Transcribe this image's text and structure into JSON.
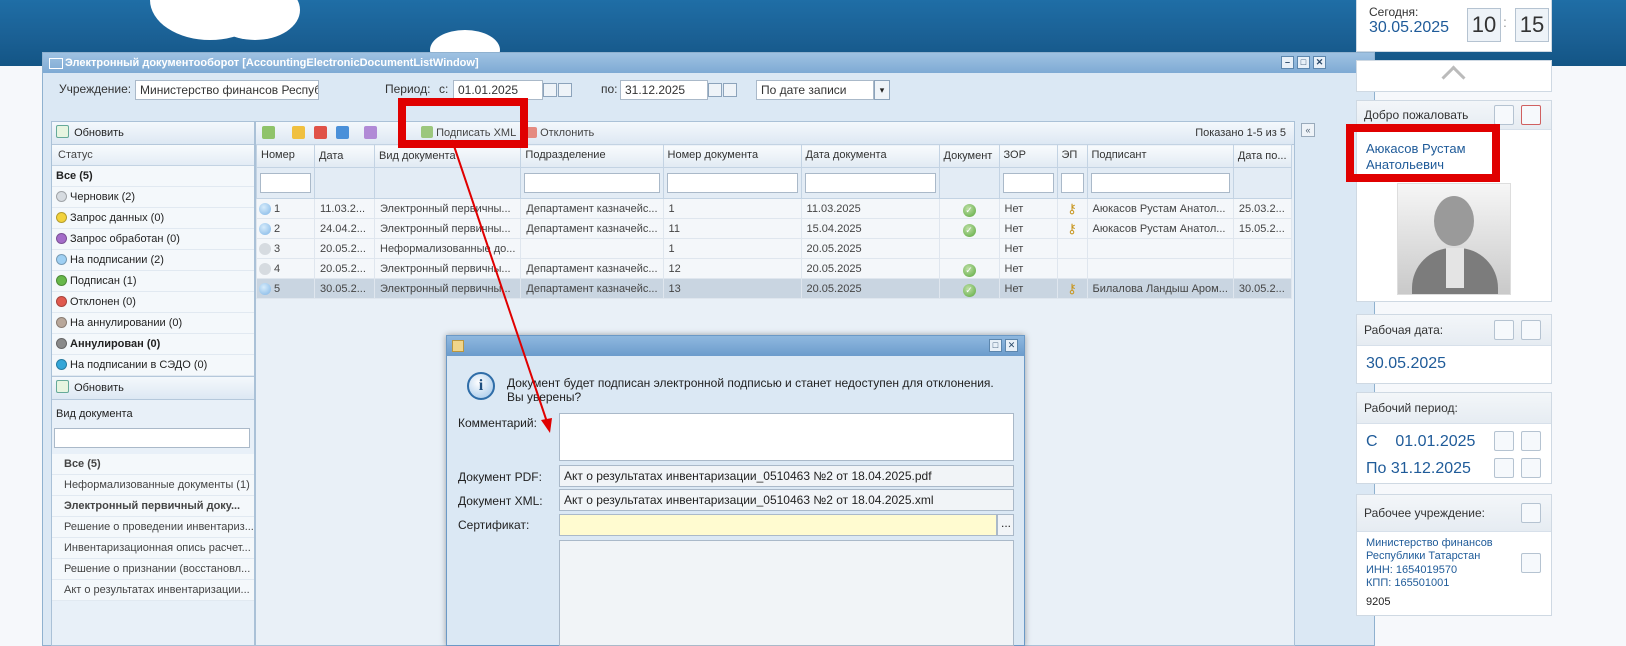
{
  "window": {
    "title": "Электронный документооборот [AccountingElectronicDocumentListWindow]"
  },
  "filter": {
    "institution_label": "Учреждение:",
    "institution_value": "Министерство финансов Республ",
    "period_label": "Период:",
    "from_label": "с:",
    "from_value": "01.01.2025",
    "to_label": "по:",
    "to_value": "31.12.2025",
    "sort_value": "По дате записи"
  },
  "status_panel": {
    "refresh_label": "Обновить",
    "header": "Статус",
    "items": [
      {
        "label": "Все (5)",
        "color": "",
        "bold": true
      },
      {
        "label": "Черновик (2)",
        "color": "#d6dbe0"
      },
      {
        "label": "Запрос данных (0)",
        "color": "#f2d23c"
      },
      {
        "label": "Запрос обработан (0)",
        "color": "#a46cc9"
      },
      {
        "label": "На подписании (2)",
        "color": "#9fd0f3"
      },
      {
        "label": "Подписан (1)",
        "color": "#67b84a"
      },
      {
        "label": "Отклонен (0)",
        "color": "#e05a4f"
      },
      {
        "label": "На аннулировании (0)",
        "color": "#b8a79a"
      },
      {
        "label": "Аннулирован (0)",
        "color": "#8a8a8a",
        "bold": true
      },
      {
        "label": "На подписании в СЭДО (0)",
        "color": "#33a6d8"
      }
    ]
  },
  "doctype_panel": {
    "refresh_label": "Обновить",
    "header": "Вид документа",
    "items": [
      {
        "label": "Все (5)",
        "bold": true
      },
      {
        "label": "Неформализованные документы (1)"
      },
      {
        "label": "Электронный первичный доку...",
        "bold": true
      },
      {
        "label": "Решение о проведении инвентариз..."
      },
      {
        "label": "Инвентаризационная опись расчет..."
      },
      {
        "label": "Решение о признании (восстановл..."
      },
      {
        "label": "Акт о результатах инвентаризации..."
      }
    ]
  },
  "grid_toolbar": {
    "sign_xml_label": "Подписать XML",
    "reject_label": "Отклонить",
    "shown_label": "Показано 1-5 из 5"
  },
  "grid": {
    "columns": [
      "Номер",
      "Дата",
      "Вид документа",
      "Подразделение",
      "Номер документа",
      "Дата документа",
      "Документ",
      "ЗОР",
      "ЭП",
      "Подписант",
      "Дата по..."
    ],
    "rows": [
      {
        "num": "1",
        "date": "11.03.2...",
        "type": "Электронный первичны...",
        "dept": "Департамент казначейс...",
        "docnum": "1",
        "docdate": "11.03.2025",
        "doc": true,
        "zor": "Нет",
        "ep": true,
        "signer": "Аюкасов Рустам Анатол...",
        "signdate": "25.03.2..."
      },
      {
        "num": "2",
        "date": "24.04.2...",
        "type": "Электронный первичны...",
        "dept": "Департамент казначейс...",
        "docnum": "11",
        "docdate": "15.04.2025",
        "doc": true,
        "zor": "Нет",
        "ep": true,
        "signer": "Аюкасов Рустам Анатол...",
        "signdate": "15.05.2..."
      },
      {
        "num": "3",
        "date": "20.05.2...",
        "type": "Неформализованные до...",
        "dept": "",
        "docnum": "1",
        "docdate": "20.05.2025",
        "doc": false,
        "zor": "Нет",
        "ep": false,
        "signer": "",
        "signdate": ""
      },
      {
        "num": "4",
        "date": "20.05.2...",
        "type": "Электронный первичны...",
        "dept": "Департамент казначейс...",
        "docnum": "12",
        "docdate": "20.05.2025",
        "doc": true,
        "zor": "Нет",
        "ep": false,
        "signer": "",
        "signdate": ""
      },
      {
        "num": "5",
        "date": "30.05.2...",
        "type": "Электронный первичны...",
        "dept": "Департамент казначейс...",
        "docnum": "13",
        "docdate": "20.05.2025",
        "doc": true,
        "zor": "Нет",
        "ep": true,
        "signer": "Билалова Ландыш Аром...",
        "signdate": "30.05.2..."
      }
    ]
  },
  "dialog": {
    "message": "Документ будет подписан электронной подписью и станет недоступен для отклонения. Вы уверены?",
    "comment_label": "Комментарий:",
    "pdf_label": "Документ PDF:",
    "pdf_value": "Акт о результатах инвентаризации_0510463 №2 от 18.04.2025.pdf",
    "xml_label": "Документ XML:",
    "xml_value": "Акт о результатах инвентаризации_0510463 №2 от 18.04.2025.xml",
    "cert_label": "Сертификат:",
    "cert_button": "..."
  },
  "sidebar": {
    "today_label": "Сегодня:",
    "today_value": "30.05.2025",
    "hour": "10",
    "minute": "15",
    "clock_sep": ":",
    "welcome_label": "Добро пожаловать",
    "user_name": "Аюкасов Рустам Анатольевич",
    "work_date_label": "Рабочая дата:",
    "work_date_value": "30.05.2025",
    "work_period_label": "Рабочий период:",
    "period_from": "С    01.01.2025",
    "period_to": "По 31.12.2025",
    "work_inst_label": "Рабочее учреждение:",
    "inst_name": "Министерство финансов Республики Татарстан",
    "inst_inn": "ИНН: 1654019570",
    "inst_kpp": "КПП: 165501001",
    "inst_code": "9205"
  },
  "colors": {
    "header_blue": "#1a5f93",
    "link_blue": "#1f5b99",
    "highlight_red": "#e00000",
    "cert_yellow": "#fffbd0"
  }
}
